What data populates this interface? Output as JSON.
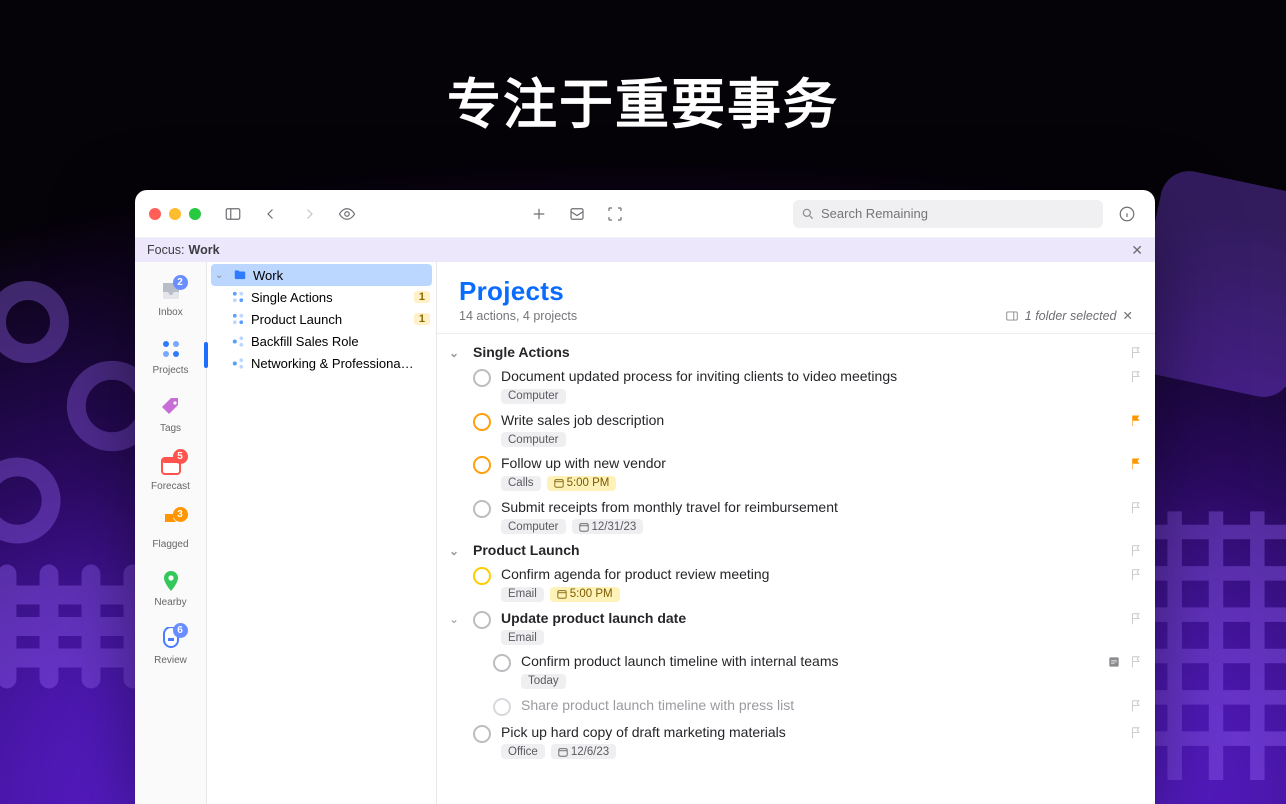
{
  "promo_title": "专注于重要事务",
  "toolbar": {
    "search_placeholder": "Search Remaining"
  },
  "focus": {
    "label": "Focus:",
    "value": "Work"
  },
  "perspectives": [
    {
      "key": "inbox",
      "label": "Inbox",
      "badge": "2",
      "badge_style": "blue"
    },
    {
      "key": "projects",
      "label": "Projects",
      "selected": true
    },
    {
      "key": "tags",
      "label": "Tags"
    },
    {
      "key": "forecast",
      "label": "Forecast",
      "badge": "5",
      "badge_style": "red"
    },
    {
      "key": "flagged",
      "label": "Flagged",
      "badge": "3",
      "badge_style": "orange"
    },
    {
      "key": "nearby",
      "label": "Nearby"
    },
    {
      "key": "review",
      "label": "Review",
      "badge": "6",
      "badge_style": "blue"
    }
  ],
  "outline": {
    "folder": {
      "name": "Work"
    },
    "projects": [
      {
        "name": "Single Actions",
        "count": "1"
      },
      {
        "name": "Product Launch",
        "count": "1"
      },
      {
        "name": "Backfill Sales Role"
      },
      {
        "name": "Networking & Professiona…"
      }
    ]
  },
  "main": {
    "title": "Projects",
    "subtitle": "14 actions, 4 projects",
    "selection_info": "1 folder selected"
  },
  "sections": [
    {
      "name": "Single Actions",
      "tasks": [
        {
          "title": "Document updated process for inviting clients to video meetings",
          "check": "normal",
          "chips": [
            {
              "t": "Computer"
            }
          ],
          "flag": false
        },
        {
          "title": "Write sales job description",
          "check": "due",
          "chips": [
            {
              "t": "Computer"
            }
          ],
          "flag": true
        },
        {
          "title": "Follow up with new vendor",
          "check": "due",
          "chips": [
            {
              "t": "Calls"
            },
            {
              "t": "5:00 PM",
              "due": true,
              "cal": true
            }
          ],
          "flag": true
        },
        {
          "title": "Submit receipts from monthly travel for reimbursement",
          "check": "repeat",
          "chips": [
            {
              "t": "Computer"
            },
            {
              "t": "12/31/23",
              "cal": true
            }
          ],
          "flag": false
        }
      ]
    },
    {
      "name": "Product Launch",
      "tasks": [
        {
          "title": "Confirm agenda for product review meeting",
          "check": "soon",
          "chips": [
            {
              "t": "Email"
            },
            {
              "t": "5:00 PM",
              "due": true,
              "cal": true
            }
          ],
          "flag": false
        },
        {
          "title": "Update product launch date",
          "check": "normal",
          "bold": true,
          "disclose": true,
          "chips": [
            {
              "t": "Email"
            }
          ],
          "flag": false,
          "subtasks": [
            {
              "title": "Confirm product launch timeline with internal teams",
              "check": "normal",
              "chips": [
                {
                  "t": "Today"
                }
              ],
              "note": true,
              "flag": false
            },
            {
              "title": "Share product launch timeline with press list",
              "check": "dim",
              "dim": true,
              "flag": false
            }
          ]
        },
        {
          "title": "Pick up hard copy of draft marketing materials",
          "check": "normal",
          "chips": [
            {
              "t": "Office"
            },
            {
              "t": "12/6/23",
              "cal": true
            }
          ],
          "flag": false
        }
      ]
    }
  ]
}
